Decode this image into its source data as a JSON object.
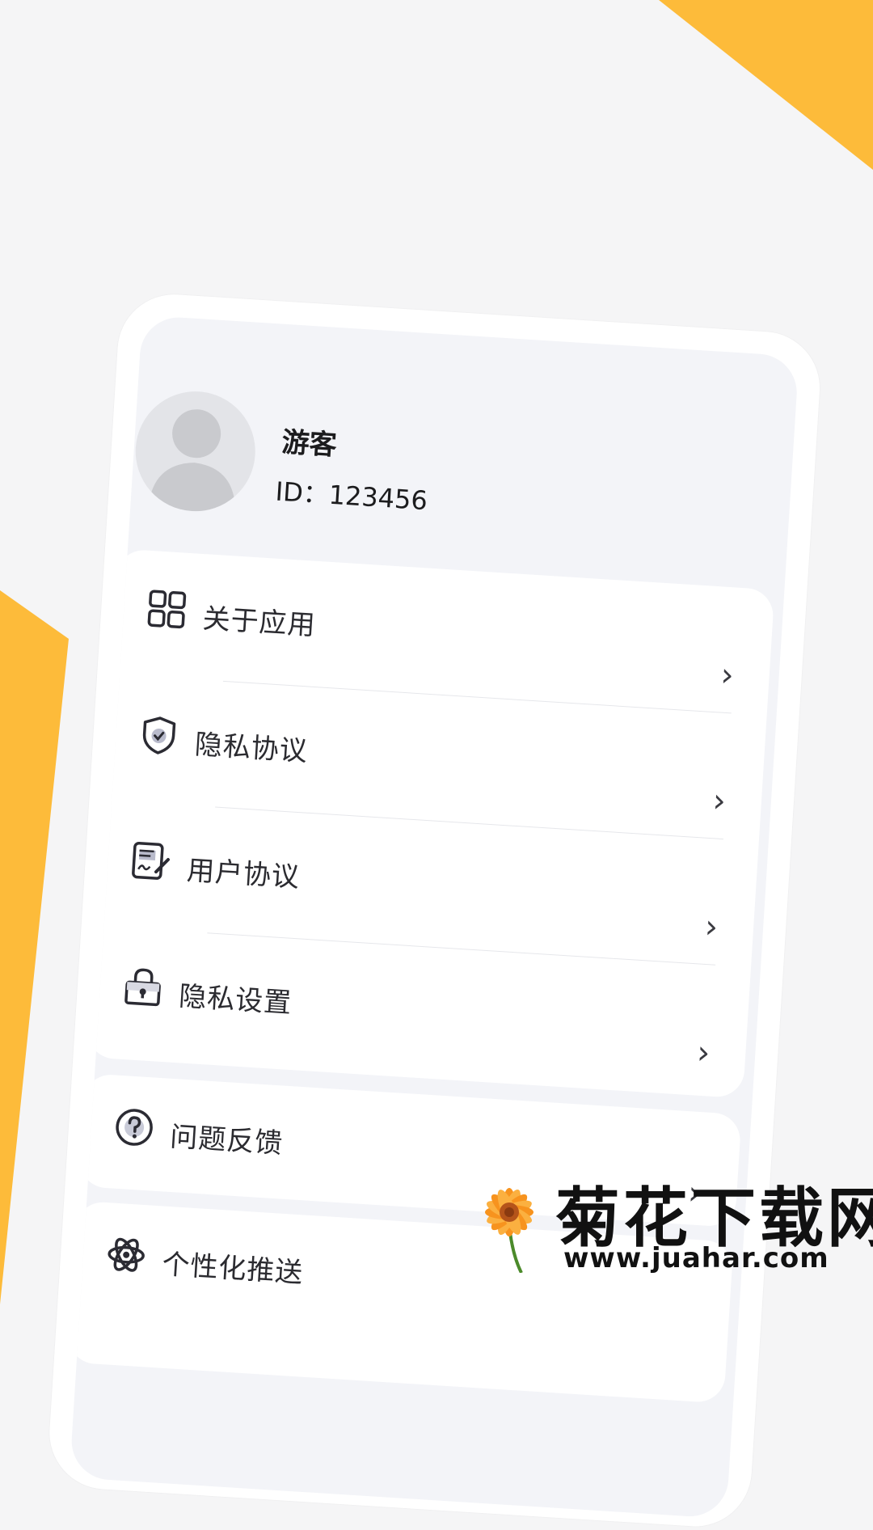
{
  "colors": {
    "accent": "#fdbb3a",
    "background": "#f5f5f6",
    "card": "#ffffff"
  },
  "profile": {
    "name": "游客",
    "id_label": "ID：123456"
  },
  "menu": {
    "items": [
      {
        "label": "关于应用",
        "icon": "grid-icon"
      },
      {
        "label": "隐私协议",
        "icon": "shield-check-icon"
      },
      {
        "label": "用户协议",
        "icon": "document-sign-icon"
      },
      {
        "label": "隐私设置",
        "icon": "lock-icon"
      }
    ]
  },
  "feedback": {
    "label": "问题反馈",
    "icon": "question-icon"
  },
  "push": {
    "label": "个性化推送",
    "icon": "atom-icon"
  },
  "chevron": "›",
  "watermark": {
    "title": "菊花下载网",
    "url": "www.juahar.com"
  }
}
